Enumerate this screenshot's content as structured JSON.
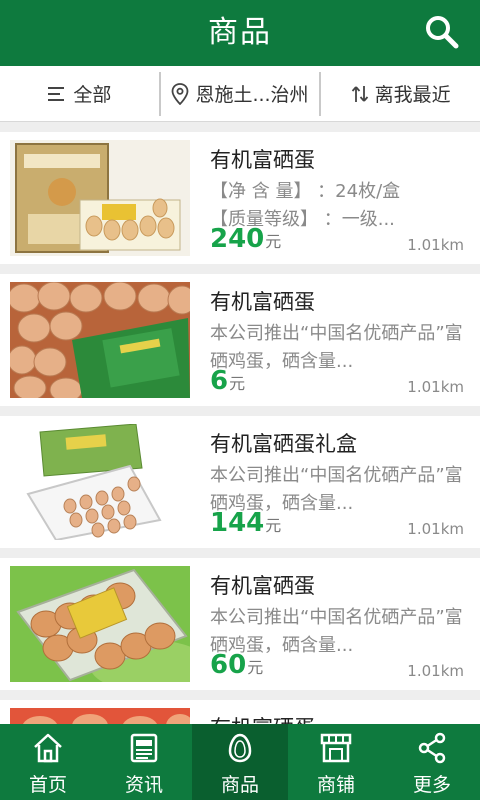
{
  "header": {
    "title": "商品",
    "search_icon": "search-icon"
  },
  "filters": {
    "category": "全部",
    "location": "恩施土...治州",
    "sort": "离我最近"
  },
  "products": [
    {
      "name": "有机富硒蛋",
      "desc": "【净 含 量】 ：24枚/盒\n【质量等级】 ：一级...",
      "price": "240",
      "unit": "元",
      "distance": "1.01km",
      "image": "egg-gift-box"
    },
    {
      "name": "有机富硒蛋",
      "desc": "本公司推出“中国名优硒产品”富硒鸡蛋，硒含量...",
      "price": "6",
      "unit": "元",
      "distance": "1.01km",
      "image": "brown-eggs-closeup"
    },
    {
      "name": "有机富硒蛋礼盒",
      "desc": "本公司推出“中国名优硒产品”富硒鸡蛋，硒含量...",
      "price": "144",
      "unit": "元",
      "distance": "1.01km",
      "image": "egg-tray-box"
    },
    {
      "name": "有机富硒蛋",
      "desc": "本公司推出“中国名优硒产品”富硒鸡蛋，硒含量...",
      "price": "60",
      "unit": "元",
      "distance": "1.01km",
      "image": "egg-plastic-pack"
    },
    {
      "name": "有机富硒蛋",
      "desc": "",
      "price": "",
      "unit": "",
      "distance": "",
      "image": "eggs-net-bag"
    }
  ],
  "tabs": [
    {
      "label": "首页",
      "icon": "home-icon"
    },
    {
      "label": "资讯",
      "icon": "news-icon"
    },
    {
      "label": "商品",
      "icon": "egg-icon",
      "active": true
    },
    {
      "label": "商铺",
      "icon": "store-icon"
    },
    {
      "label": "更多",
      "icon": "share-icon"
    }
  ],
  "colors": {
    "brand": "#0e7a3e",
    "brand_dark": "#0a5f2f",
    "price": "#17a34a"
  }
}
